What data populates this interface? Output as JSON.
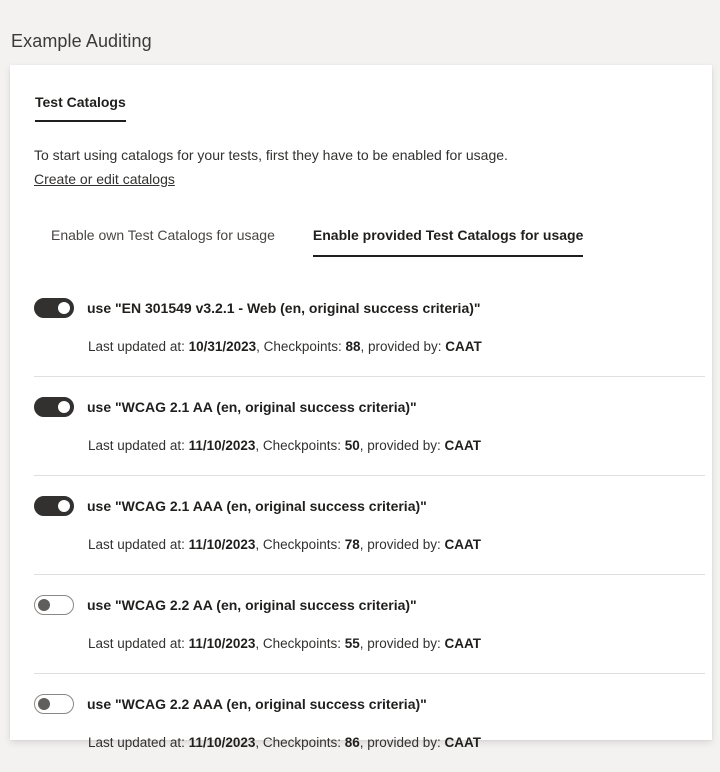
{
  "page": {
    "title": "Example Auditing"
  },
  "card": {
    "primary_tab": "Test Catalogs",
    "intro_text": "To start using catalogs for your tests, first they have to be enabled for usage.",
    "intro_link": "Create or edit catalogs",
    "pivots": [
      {
        "label": "Enable own Test Catalogs for usage",
        "active": false
      },
      {
        "label": "Enable provided Test Catalogs for usage",
        "active": true
      }
    ],
    "meta_labels": {
      "last_updated_prefix": "Last updated at: ",
      "checkpoints_prefix": ", Checkpoints: ",
      "provided_by_prefix": ", provided by: "
    },
    "catalogs": [
      {
        "label": "use \"EN 301549 v3.2.1 - Web (en, original success criteria)\"",
        "enabled": true,
        "last_updated": "10/31/2023",
        "checkpoints": "88",
        "provided_by": "CAAT"
      },
      {
        "label": "use \"WCAG 2.1 AA (en, original success criteria)\"",
        "enabled": true,
        "last_updated": "11/10/2023",
        "checkpoints": "50",
        "provided_by": "CAAT"
      },
      {
        "label": "use \"WCAG 2.1 AAA (en, original success criteria)\"",
        "enabled": true,
        "last_updated": "11/10/2023",
        "checkpoints": "78",
        "provided_by": "CAAT"
      },
      {
        "label": "use \"WCAG 2.2 AA (en, original success criteria)\"",
        "enabled": false,
        "last_updated": "11/10/2023",
        "checkpoints": "55",
        "provided_by": "CAAT"
      },
      {
        "label": "use \"WCAG 2.2 AAA (en, original success criteria)\"",
        "enabled": false,
        "last_updated": "11/10/2023",
        "checkpoints": "86",
        "provided_by": "CAAT"
      }
    ]
  },
  "colors": {
    "page_bg": "#f3f2f1",
    "card_bg": "#ffffff",
    "accent": "#201f1e",
    "divider": "#e1dfdd",
    "toggle_on": "#323130",
    "toggle_off_border": "#8a8886",
    "toggle_off_knob": "#605e5c"
  }
}
